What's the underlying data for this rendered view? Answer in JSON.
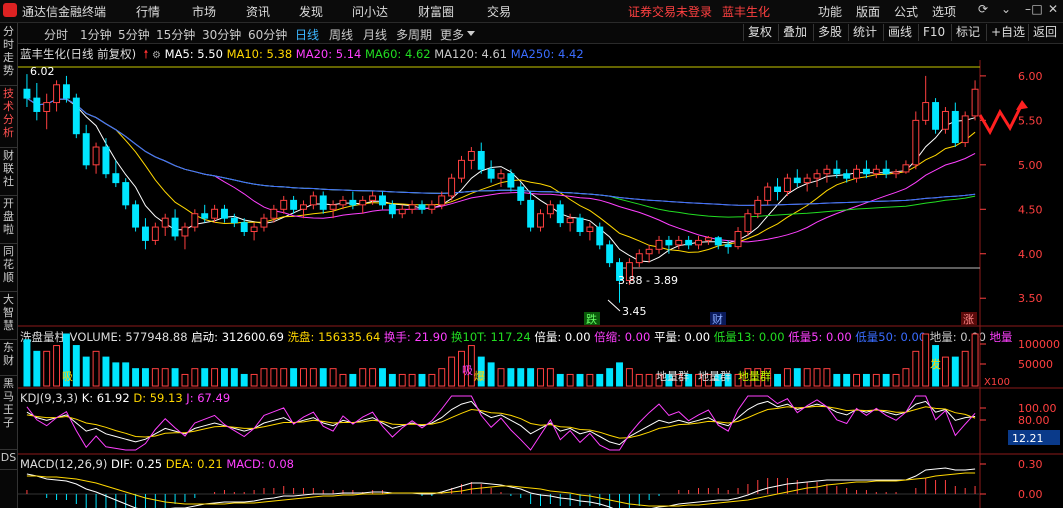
{
  "menubar": {
    "app_title": "通达信金融终端",
    "menus": [
      "行情",
      "市场",
      "资讯",
      "发现",
      "问小达",
      "财富圈",
      "交易"
    ],
    "warning": "证券交易未登录",
    "stock_name": "蓝丰生化",
    "right_menus": [
      "功能",
      "版面",
      "公式",
      "选项"
    ],
    "icons": [
      "refresh-icon",
      "collapse-icon",
      "minimize-icon",
      "maximize-icon",
      "close-icon"
    ]
  },
  "left_tabs": [
    "分时走势",
    "技术分析",
    "财联社",
    "开盘啦",
    "同花顺",
    "大智慧",
    "东财",
    "黑马王子",
    "DS"
  ],
  "toolbar": {
    "periods": [
      "分时",
      "1分钟",
      "5分钟",
      "15分钟",
      "30分钟",
      "60分钟",
      "日线",
      "周线",
      "月线",
      "多周期",
      "更多"
    ],
    "selected": "日线",
    "right_buttons": [
      "复权",
      "叠加",
      "多股",
      "统计",
      "画线",
      "F10",
      "标记",
      "+自选",
      "返回"
    ]
  },
  "main_info": {
    "title": "蓝丰生化(日线 前复权)",
    "ma": [
      {
        "label": "MA5: 5.50",
        "color": "#ffffff"
      },
      {
        "label": "MA10: 5.38",
        "color": "#ffd700"
      },
      {
        "label": "MA20: 5.14",
        "color": "#ff40ff"
      },
      {
        "label": "MA60: 4.62",
        "color": "#22dd22"
      },
      {
        "label": "MA120: 4.61",
        "color": "#c8c8c8"
      },
      {
        "label": "MA250: 4.42",
        "color": "#3a6cff"
      }
    ]
  },
  "volume_info": {
    "title": "洗盘量柱 VOLUME: 577948.88",
    "items": [
      {
        "label": "启动: 312600.69",
        "color": "#ffffff"
      },
      {
        "label": "洗盘: 156335.64",
        "color": "#ffd700"
      },
      {
        "label": "换手: 21.90",
        "color": "#ff40ff"
      },
      {
        "label": "换10T: 117.24",
        "color": "#22dd22"
      },
      {
        "label": "倍量: 0.00",
        "color": "#ffffff"
      },
      {
        "label": "倍缩: 0.00",
        "color": "#ff40ff"
      },
      {
        "label": "平量: 0.00",
        "color": "#ffffff"
      },
      {
        "label": "低量13: 0.00",
        "color": "#22dd22"
      },
      {
        "label": "低量5: 0.00",
        "color": "#ff40ff"
      },
      {
        "label": "低量50: 0.00",
        "color": "#3a6cff"
      },
      {
        "label": "地量: 0.00",
        "color": "#c8c8c8"
      },
      {
        "label": "地量",
        "color": "#ff40ff"
      }
    ]
  },
  "kdj_info": {
    "title": "KDJ(9,3,3)",
    "items": [
      {
        "label": "K: 61.92",
        "color": "#ffffff"
      },
      {
        "label": "D: 59.13",
        "color": "#ffd700"
      },
      {
        "label": "J: 67.49",
        "color": "#ff40ff"
      }
    ]
  },
  "macd_info": {
    "title": "MACD(12,26,9)",
    "items": [
      {
        "label": "DIF: 0.25",
        "color": "#ffffff"
      },
      {
        "label": "DEA: 0.21",
        "color": "#ffd700"
      },
      {
        "label": "MACD: 0.08",
        "color": "#ff40ff"
      }
    ]
  },
  "axis": {
    "price_ticks": [
      "6.00",
      "5.50",
      "5.00",
      "4.50",
      "4.00",
      "3.50"
    ],
    "volume_ticks": [
      "100000",
      "50000"
    ],
    "volume_unit": "X100",
    "kdj_ticks": [
      "100.00",
      "80.00"
    ],
    "kdj_current": "12.21",
    "macd_ticks": [
      "0.30",
      "0.00"
    ]
  },
  "annotations": {
    "high_label": "6.02",
    "low_label": "3.45",
    "range_label": "3.88 - 3.89",
    "badge_die": "跌",
    "badge_cai": "财",
    "badge_zhang": "涨",
    "badge_jian": "减",
    "badge_fa": "发",
    "vol_labels": [
      "地量群",
      "地量群",
      "地量群"
    ],
    "vol_yellow": [
      "吸",
      "爆",
      "吸"
    ]
  },
  "chart_data": {
    "type": "candlestick",
    "ylim": [
      3.3,
      6.1
    ],
    "candles": [
      [
        5.85,
        6.02,
        5.65,
        5.75
      ],
      [
        5.75,
        5.92,
        5.5,
        5.6
      ],
      [
        5.6,
        5.8,
        5.4,
        5.7
      ],
      [
        5.7,
        5.95,
        5.6,
        5.9
      ],
      [
        5.9,
        6.0,
        5.7,
        5.75
      ],
      [
        5.75,
        5.8,
        5.3,
        5.35
      ],
      [
        5.35,
        5.45,
        4.95,
        5.0
      ],
      [
        5.0,
        5.25,
        4.9,
        5.2
      ],
      [
        5.2,
        5.3,
        4.85,
        4.9
      ],
      [
        4.9,
        5.05,
        4.75,
        4.8
      ],
      [
        4.8,
        4.85,
        4.5,
        4.55
      ],
      [
        4.55,
        4.6,
        4.25,
        4.3
      ],
      [
        4.3,
        4.4,
        4.05,
        4.15
      ],
      [
        4.15,
        4.35,
        4.1,
        4.3
      ],
      [
        4.3,
        4.45,
        4.2,
        4.4
      ],
      [
        4.4,
        4.5,
        4.15,
        4.2
      ],
      [
        4.2,
        4.35,
        4.05,
        4.3
      ],
      [
        4.3,
        4.5,
        4.25,
        4.45
      ],
      [
        4.45,
        4.55,
        4.35,
        4.4
      ],
      [
        4.4,
        4.55,
        4.35,
        4.5
      ],
      [
        4.5,
        4.55,
        4.35,
        4.4
      ],
      [
        4.4,
        4.45,
        4.3,
        4.35
      ],
      [
        4.35,
        4.4,
        4.2,
        4.25
      ],
      [
        4.25,
        4.35,
        4.15,
        4.3
      ],
      [
        4.3,
        4.45,
        4.25,
        4.4
      ],
      [
        4.4,
        4.55,
        4.35,
        4.5
      ],
      [
        4.5,
        4.65,
        4.45,
        4.6
      ],
      [
        4.6,
        4.65,
        4.45,
        4.5
      ],
      [
        4.5,
        4.6,
        4.4,
        4.55
      ],
      [
        4.55,
        4.7,
        4.5,
        4.65
      ],
      [
        4.65,
        4.7,
        4.45,
        4.5
      ],
      [
        4.5,
        4.6,
        4.4,
        4.55
      ],
      [
        4.55,
        4.65,
        4.5,
        4.6
      ],
      [
        4.6,
        4.7,
        4.5,
        4.55
      ],
      [
        4.55,
        4.65,
        4.45,
        4.6
      ],
      [
        4.6,
        4.7,
        4.55,
        4.65
      ],
      [
        4.65,
        4.7,
        4.5,
        4.55
      ],
      [
        4.55,
        4.6,
        4.4,
        4.45
      ],
      [
        4.45,
        4.55,
        4.4,
        4.5
      ],
      [
        4.5,
        4.6,
        4.45,
        4.55
      ],
      [
        4.55,
        4.6,
        4.45,
        4.5
      ],
      [
        4.5,
        4.6,
        4.45,
        4.55
      ],
      [
        4.55,
        4.7,
        4.5,
        4.65
      ],
      [
        4.65,
        4.9,
        4.6,
        4.85
      ],
      [
        4.85,
        5.1,
        4.8,
        5.05
      ],
      [
        5.05,
        5.2,
        4.95,
        5.15
      ],
      [
        5.15,
        5.25,
        4.9,
        4.95
      ],
      [
        4.95,
        5.05,
        4.8,
        4.85
      ],
      [
        4.85,
        4.95,
        4.75,
        4.9
      ],
      [
        4.9,
        4.95,
        4.7,
        4.75
      ],
      [
        4.75,
        4.8,
        4.55,
        4.6
      ],
      [
        4.6,
        4.7,
        4.25,
        4.3
      ],
      [
        4.3,
        4.5,
        4.25,
        4.45
      ],
      [
        4.45,
        4.6,
        4.4,
        4.55
      ],
      [
        4.55,
        4.6,
        4.3,
        4.35
      ],
      [
        4.35,
        4.45,
        4.25,
        4.4
      ],
      [
        4.4,
        4.45,
        4.2,
        4.25
      ],
      [
        4.25,
        4.35,
        4.15,
        4.3
      ],
      [
        4.3,
        4.35,
        4.05,
        4.1
      ],
      [
        4.1,
        4.15,
        3.85,
        3.9
      ],
      [
        3.9,
        3.95,
        3.45,
        3.7
      ],
      [
        3.7,
        3.95,
        3.65,
        3.9
      ],
      [
        3.9,
        4.05,
        3.85,
        4.0
      ],
      [
        4.0,
        4.1,
        3.9,
        4.05
      ],
      [
        4.05,
        4.2,
        4.0,
        4.15
      ],
      [
        4.15,
        4.2,
        4.0,
        4.1
      ],
      [
        4.1,
        4.2,
        4.05,
        4.15
      ],
      [
        4.15,
        4.2,
        4.05,
        4.1
      ],
      [
        4.1,
        4.2,
        4.05,
        4.15
      ],
      [
        4.15,
        4.2,
        4.1,
        4.18
      ],
      [
        4.18,
        4.2,
        4.05,
        4.1
      ],
      [
        4.1,
        4.15,
        4.0,
        4.08
      ],
      [
        4.08,
        4.3,
        4.05,
        4.25
      ],
      [
        4.25,
        4.5,
        4.2,
        4.45
      ],
      [
        4.45,
        4.65,
        4.4,
        4.6
      ],
      [
        4.6,
        4.8,
        4.55,
        4.75
      ],
      [
        4.75,
        4.85,
        4.6,
        4.7
      ],
      [
        4.7,
        4.9,
        4.65,
        4.85
      ],
      [
        4.85,
        4.95,
        4.75,
        4.8
      ],
      [
        4.8,
        4.9,
        4.7,
        4.85
      ],
      [
        4.85,
        4.95,
        4.75,
        4.9
      ],
      [
        4.9,
        5.0,
        4.8,
        4.95
      ],
      [
        4.95,
        5.05,
        4.85,
        4.9
      ],
      [
        4.9,
        4.95,
        4.8,
        4.85
      ],
      [
        4.85,
        5.0,
        4.8,
        4.95
      ],
      [
        4.95,
        5.05,
        4.85,
        4.9
      ],
      [
        4.9,
        5.0,
        4.85,
        4.95
      ],
      [
        4.95,
        5.05,
        4.85,
        4.9
      ],
      [
        4.9,
        4.95,
        4.85,
        4.92
      ],
      [
        4.92,
        5.05,
        4.9,
        5.0
      ],
      [
        5.0,
        5.6,
        4.95,
        5.5
      ],
      [
        5.5,
        6.0,
        5.45,
        5.7
      ],
      [
        5.7,
        5.75,
        5.35,
        5.4
      ],
      [
        5.4,
        5.65,
        5.35,
        5.6
      ],
      [
        5.6,
        5.7,
        5.2,
        5.25
      ],
      [
        5.25,
        5.6,
        5.2,
        5.55
      ],
      [
        5.55,
        5.95,
        5.5,
        5.85
      ]
    ],
    "ma5_color": "#ffffff",
    "ma10_color": "#ffd700",
    "ma20_color": "#ff40ff",
    "ma60_color": "#22dd22",
    "ma120_color": "#c8c8c8",
    "ma250_color": "#3a6cff",
    "up_color": "#ff4040",
    "down_color": "#00e5ff",
    "volume": [
      8,
      6,
      6,
      7,
      9,
      7,
      5,
      6,
      5,
      4,
      4,
      3,
      3,
      3,
      3,
      3,
      2,
      3,
      3,
      3,
      3,
      3,
      2,
      2,
      3,
      3,
      3,
      3,
      3,
      3,
      3,
      3,
      2,
      2,
      3,
      3,
      3,
      2,
      2,
      2,
      2,
      2,
      3,
      5,
      6,
      7,
      5,
      4,
      3,
      3,
      3,
      3,
      3,
      3,
      2,
      2,
      2,
      2,
      2,
      3,
      4,
      3,
      2,
      2,
      2,
      2,
      2,
      2,
      2,
      2,
      2,
      2,
      2,
      3,
      3,
      3,
      2,
      3,
      3,
      3,
      3,
      3,
      2,
      2,
      2,
      2,
      2,
      2,
      2,
      3,
      6,
      9,
      7,
      5,
      5,
      6,
      9
    ],
    "kdj_k": [
      70,
      60,
      55,
      60,
      65,
      50,
      35,
      40,
      30,
      25,
      20,
      15,
      20,
      30,
      40,
      35,
      30,
      40,
      45,
      50,
      45,
      40,
      35,
      40,
      50,
      55,
      60,
      50,
      55,
      60,
      50,
      45,
      55,
      50,
      55,
      60,
      50,
      40,
      45,
      50,
      45,
      50,
      60,
      75,
      85,
      90,
      70,
      60,
      65,
      55,
      45,
      30,
      40,
      50,
      35,
      40,
      30,
      35,
      25,
      15,
      10,
      25,
      35,
      45,
      55,
      50,
      55,
      50,
      55,
      60,
      50,
      45,
      60,
      75,
      85,
      90,
      80,
      85,
      75,
      80,
      85,
      80,
      70,
      65,
      75,
      70,
      75,
      70,
      65,
      70,
      85,
      90,
      70,
      75,
      55,
      60,
      62
    ],
    "kdj_d": [
      65,
      62,
      60,
      60,
      62,
      57,
      50,
      47,
      42,
      36,
      31,
      25,
      24,
      26,
      31,
      32,
      32,
      35,
      39,
      43,
      44,
      42,
      40,
      40,
      43,
      47,
      51,
      51,
      52,
      55,
      53,
      50,
      51,
      51,
      52,
      55,
      53,
      48,
      47,
      48,
      47,
      48,
      52,
      60,
      68,
      75,
      73,
      69,
      68,
      64,
      58,
      49,
      46,
      47,
      43,
      42,
      38,
      37,
      33,
      27,
      22,
      23,
      27,
      33,
      40,
      43,
      47,
      48,
      50,
      53,
      52,
      50,
      53,
      60,
      68,
      75,
      77,
      80,
      78,
      79,
      81,
      80,
      77,
      73,
      74,
      73,
      74,
      73,
      70,
      70,
      75,
      80,
      77,
      76,
      69,
      66,
      59
    ],
    "macd_dif": [
      0.2,
      0.18,
      0.15,
      0.14,
      0.13,
      0.1,
      0.05,
      0.02,
      -0.02,
      -0.06,
      -0.1,
      -0.14,
      -0.16,
      -0.16,
      -0.15,
      -0.14,
      -0.14,
      -0.12,
      -0.1,
      -0.09,
      -0.08,
      -0.08,
      -0.08,
      -0.07,
      -0.05,
      -0.04,
      -0.02,
      -0.02,
      -0.01,
      0.0,
      0.0,
      0.0,
      0.01,
      0.01,
      0.01,
      0.02,
      0.02,
      0.01,
      0.01,
      0.01,
      0.0,
      0.0,
      0.02,
      0.05,
      0.08,
      0.11,
      0.11,
      0.1,
      0.09,
      0.07,
      0.05,
      0.01,
      -0.01,
      -0.02,
      -0.04,
      -0.05,
      -0.07,
      -0.08,
      -0.1,
      -0.13,
      -0.17,
      -0.18,
      -0.17,
      -0.15,
      -0.13,
      -0.12,
      -0.1,
      -0.09,
      -0.08,
      -0.07,
      -0.06,
      -0.06,
      -0.04,
      -0.01,
      0.03,
      0.06,
      0.08,
      0.1,
      0.11,
      0.12,
      0.13,
      0.14,
      0.14,
      0.14,
      0.14,
      0.14,
      0.14,
      0.14,
      0.14,
      0.14,
      0.18,
      0.24,
      0.25,
      0.26,
      0.24,
      0.24,
      0.25
    ],
    "macd_dea": [
      0.18,
      0.18,
      0.17,
      0.17,
      0.16,
      0.15,
      0.13,
      0.11,
      0.08,
      0.05,
      0.02,
      -0.01,
      -0.04,
      -0.06,
      -0.08,
      -0.09,
      -0.1,
      -0.1,
      -0.1,
      -0.1,
      -0.1,
      -0.09,
      -0.09,
      -0.09,
      -0.08,
      -0.07,
      -0.06,
      -0.05,
      -0.04,
      -0.03,
      -0.02,
      -0.02,
      -0.01,
      -0.01,
      0.0,
      0.0,
      0.0,
      0.01,
      0.01,
      0.01,
      0.01,
      0.01,
      0.01,
      0.02,
      0.03,
      0.05,
      0.06,
      0.07,
      0.08,
      0.08,
      0.07,
      0.06,
      0.05,
      0.03,
      0.02,
      0.01,
      -0.01,
      -0.02,
      -0.04,
      -0.06,
      -0.08,
      -0.1,
      -0.11,
      -0.12,
      -0.12,
      -0.12,
      -0.12,
      -0.11,
      -0.11,
      -0.1,
      -0.09,
      -0.08,
      -0.07,
      -0.06,
      -0.04,
      -0.02,
      0.0,
      0.02,
      0.04,
      0.06,
      0.07,
      0.09,
      0.1,
      0.11,
      0.12,
      0.12,
      0.13,
      0.13,
      0.13,
      0.14,
      0.15,
      0.16,
      0.18,
      0.19,
      0.2,
      0.21,
      0.21
    ]
  }
}
